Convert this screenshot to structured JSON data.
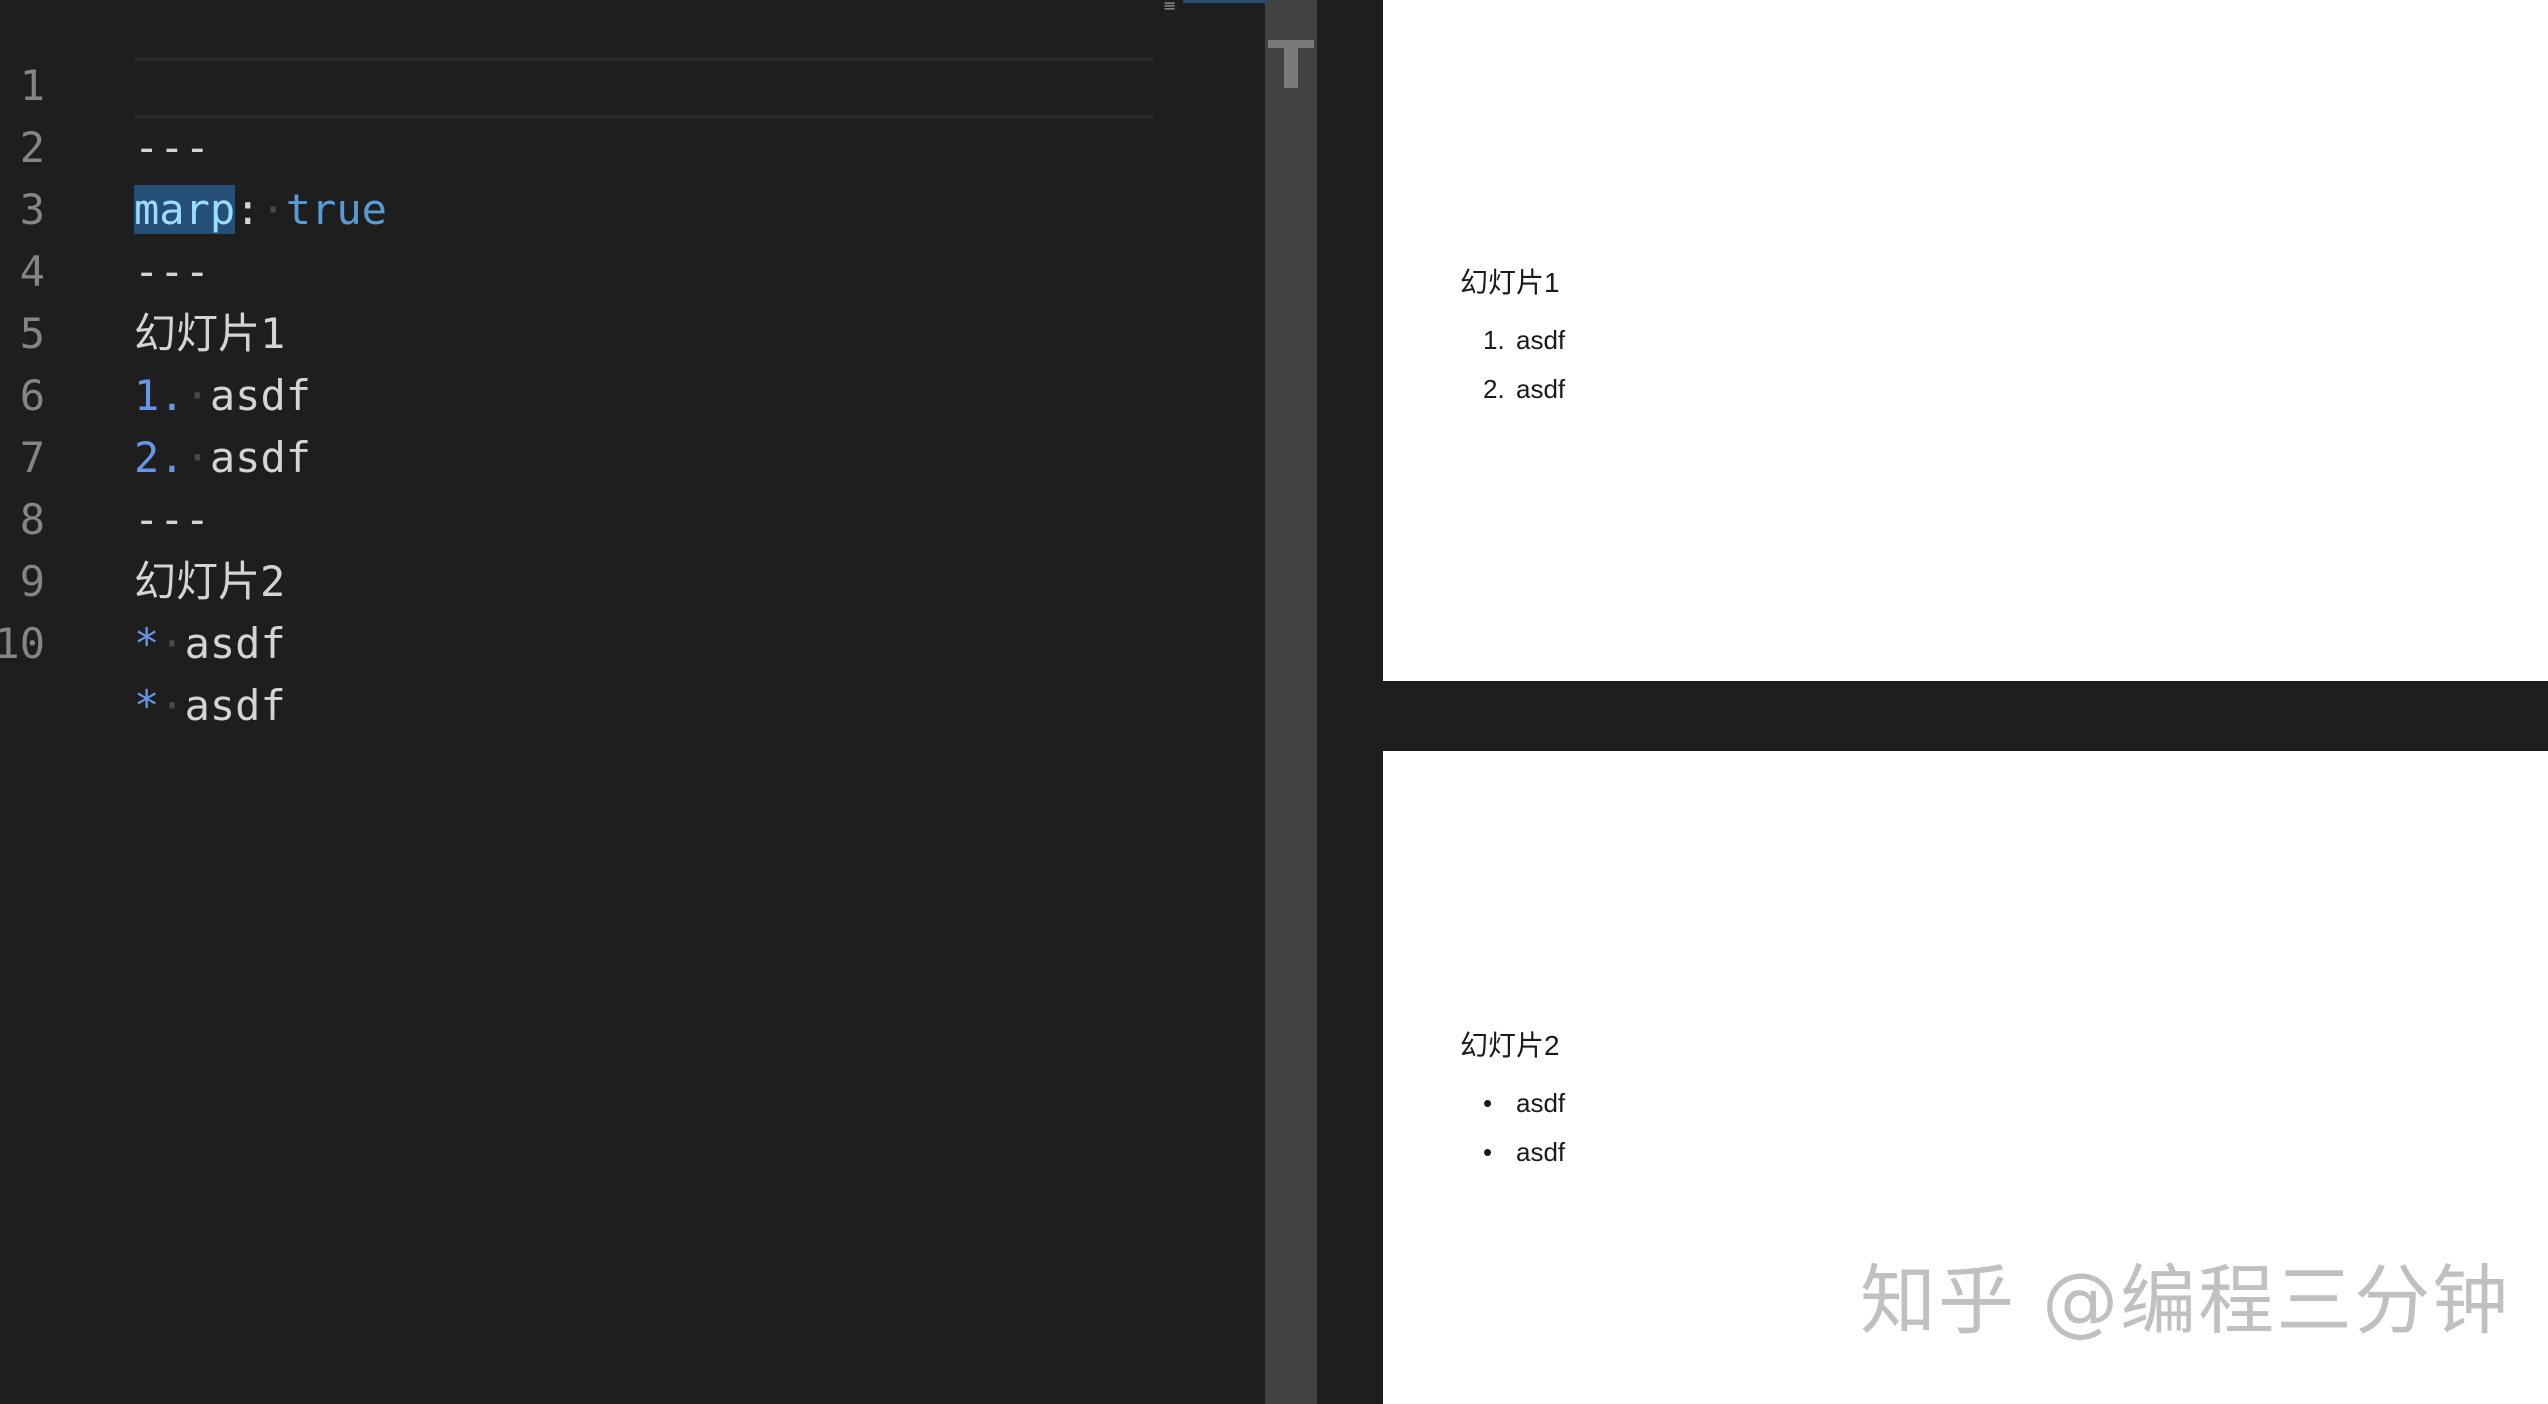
{
  "editor": {
    "lines": [
      {
        "number": "1",
        "text": "---"
      },
      {
        "number": "2",
        "key": "marp",
        "colon": ":",
        "space": "·",
        "value": "true"
      },
      {
        "number": "3",
        "text": "---"
      },
      {
        "number": "4",
        "text": "幻灯片1"
      },
      {
        "number": "5",
        "marker": "1.",
        "space": "·",
        "text": "asdf"
      },
      {
        "number": "6",
        "marker": "2.",
        "space": "·",
        "text": "asdf"
      },
      {
        "number": "7",
        "text": "---"
      },
      {
        "number": "8",
        "text": "幻灯片2"
      },
      {
        "number": "9",
        "marker": "*",
        "space": "·",
        "text": "asdf"
      },
      {
        "number": "10",
        "marker": "*",
        "space": "·",
        "text": "asdf"
      }
    ],
    "fold_glyph": "≡"
  },
  "preview": {
    "slides": [
      {
        "heading": "幻灯片1",
        "list_type": "ordered",
        "items": [
          {
            "marker": "1.",
            "text": "asdf"
          },
          {
            "marker": "2.",
            "text": "asdf"
          }
        ]
      },
      {
        "heading": "幻灯片2",
        "list_type": "unordered",
        "items": [
          {
            "marker": "•",
            "text": "asdf"
          },
          {
            "marker": "•",
            "text": "asdf"
          }
        ]
      }
    ]
  },
  "watermark": "知乎 @编程三分钟",
  "colors": {
    "editor_bg": "#1e1e1e",
    "line_number": "#858585",
    "yaml_key": "#9cdcfe",
    "yaml_value": "#569cd6",
    "list_marker": "#6796e6",
    "slide_bg": "#ffffff"
  }
}
